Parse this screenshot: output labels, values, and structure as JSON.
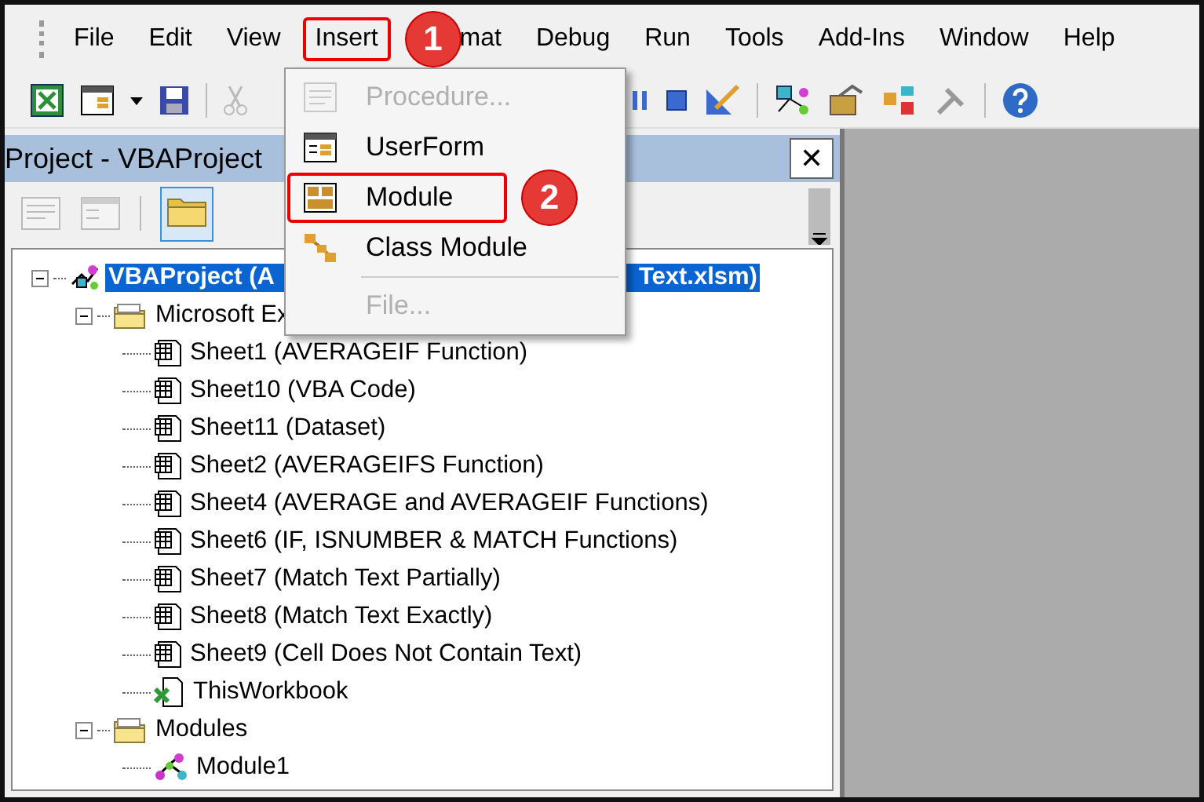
{
  "menu_bar": {
    "items": [
      {
        "label": "File",
        "annotated": false
      },
      {
        "label": "Edit",
        "annotated": false
      },
      {
        "label": "View",
        "annotated": false
      },
      {
        "label": "Insert",
        "annotated": true,
        "callout": "1"
      },
      {
        "label": "mat",
        "annotated": false
      },
      {
        "label": "Debug",
        "annotated": false
      },
      {
        "label": "Run",
        "annotated": false
      },
      {
        "label": "Tools",
        "annotated": false
      },
      {
        "label": "Add-Ins",
        "annotated": false
      },
      {
        "label": "Window",
        "annotated": false
      },
      {
        "label": "Help",
        "annotated": false
      }
    ]
  },
  "insert_menu": {
    "items": [
      {
        "kind": "procedure",
        "label": "Procedure...",
        "disabled": true,
        "annotated": false,
        "separator_before": false
      },
      {
        "kind": "userform",
        "label": "UserForm",
        "disabled": false,
        "annotated": false,
        "separator_before": false
      },
      {
        "kind": "module",
        "label": "Module",
        "disabled": false,
        "annotated": true,
        "callout": "2",
        "separator_before": false
      },
      {
        "kind": "class-module",
        "label": "Class Module",
        "disabled": false,
        "annotated": false,
        "separator_before": false
      },
      {
        "kind": "file",
        "label": "File...",
        "disabled": true,
        "annotated": false,
        "separator_before": true
      }
    ]
  },
  "project_pane": {
    "title": "Project - VBAProject",
    "close": "✕",
    "tree": [
      {
        "kind": "project",
        "label": "VBAProject (A",
        "label_right": "Text.xlsm)",
        "selected": true,
        "expanded": true,
        "children": [
          {
            "kind": "folder",
            "label": "Microsoft Ex",
            "selected": false,
            "expanded": true,
            "children": [
              {
                "kind": "sheet",
                "label": "Sheet1 (AVERAGEIF Function)",
                "selected": false
              },
              {
                "kind": "sheet",
                "label": "Sheet10 (VBA Code)",
                "selected": false
              },
              {
                "kind": "sheet",
                "label": "Sheet11 (Dataset)",
                "selected": false
              },
              {
                "kind": "sheet",
                "label": "Sheet2 (AVERAGEIFS Function)",
                "selected": false
              },
              {
                "kind": "sheet",
                "label": "Sheet4 (AVERAGE and AVERAGEIF Functions)",
                "selected": false
              },
              {
                "kind": "sheet",
                "label": "Sheet6 (IF, ISNUMBER & MATCH Functions)",
                "selected": false
              },
              {
                "kind": "sheet",
                "label": "Sheet7 (Match Text Partially)",
                "selected": false
              },
              {
                "kind": "sheet",
                "label": "Sheet8 (Match Text Exactly)",
                "selected": false
              },
              {
                "kind": "sheet",
                "label": "Sheet9 (Cell Does Not Contain Text)",
                "selected": false
              },
              {
                "kind": "workbook",
                "label": "ThisWorkbook",
                "selected": false
              }
            ]
          },
          {
            "kind": "folder",
            "label": "Modules",
            "selected": false,
            "expanded": true,
            "children": [
              {
                "kind": "module",
                "label": "Module1",
                "selected": false
              }
            ]
          }
        ]
      }
    ]
  }
}
